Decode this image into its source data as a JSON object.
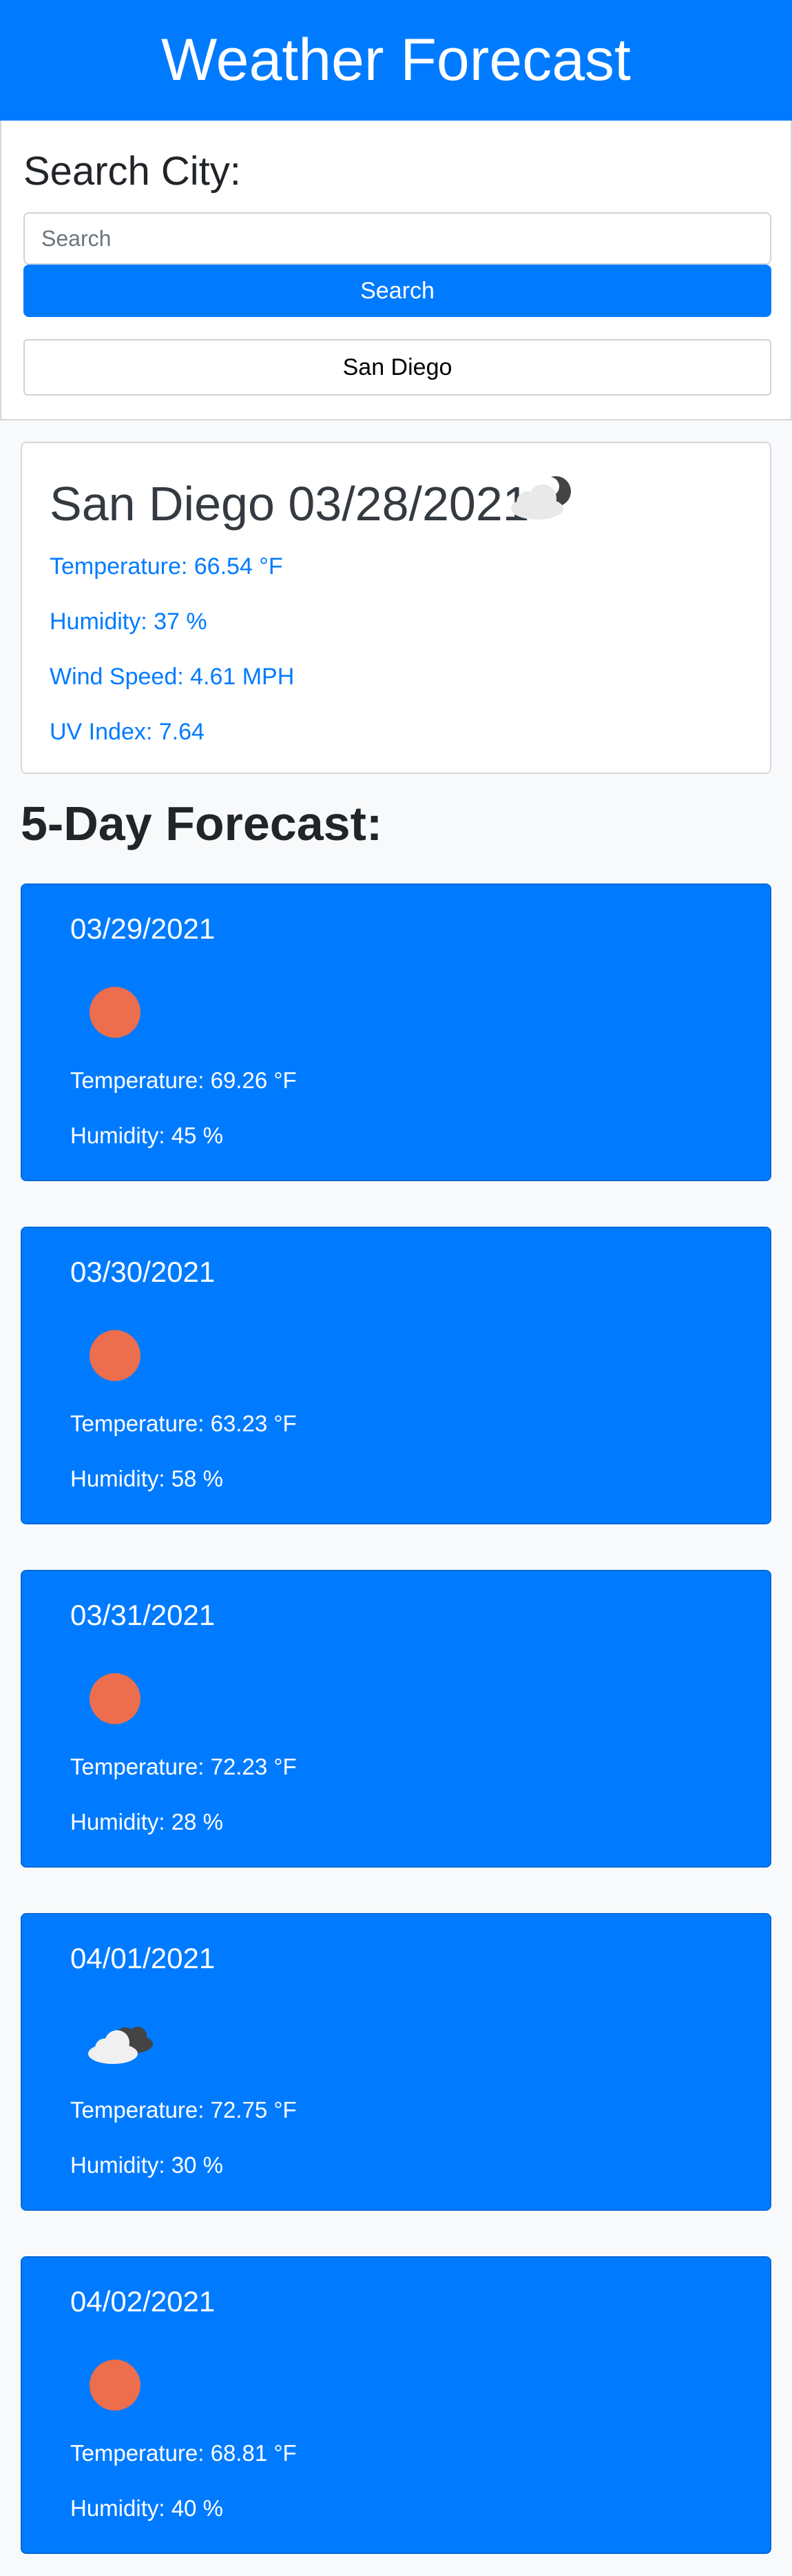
{
  "header": {
    "title": "Weather Forecast"
  },
  "search": {
    "title": "Search City:",
    "placeholder": "Search",
    "button_label": "Search",
    "history": [
      "San Diego"
    ]
  },
  "current": {
    "title": "San Diego 03/28/2021",
    "icon": "partly-cloudy-night-icon",
    "temperature": "Temperature: 66.54 °F",
    "humidity": "Humidity: 37 %",
    "wind": "Wind Speed: 4.61 MPH",
    "uv": "UV Index: 7.64"
  },
  "forecast": {
    "title": "5-Day Forecast:",
    "days": [
      {
        "date": "03/29/2021",
        "icon": "sun-icon",
        "temperature": "Temperature: 69.26 °F",
        "humidity": "Humidity: 45 %"
      },
      {
        "date": "03/30/2021",
        "icon": "sun-icon",
        "temperature": "Temperature: 63.23 °F",
        "humidity": "Humidity: 58 %"
      },
      {
        "date": "03/31/2021",
        "icon": "sun-icon",
        "temperature": "Temperature: 72.23 °F",
        "humidity": "Humidity: 28 %"
      },
      {
        "date": "04/01/2021",
        "icon": "clouds-icon",
        "temperature": "Temperature: 72.75 °F",
        "humidity": "Humidity: 30 %"
      },
      {
        "date": "04/02/2021",
        "icon": "sun-icon",
        "temperature": "Temperature: 68.81 °F",
        "humidity": "Humidity: 40 %"
      }
    ]
  },
  "colors": {
    "primary": "#007bff",
    "sun": "#ec6e4c",
    "background": "#f8f9fa"
  }
}
